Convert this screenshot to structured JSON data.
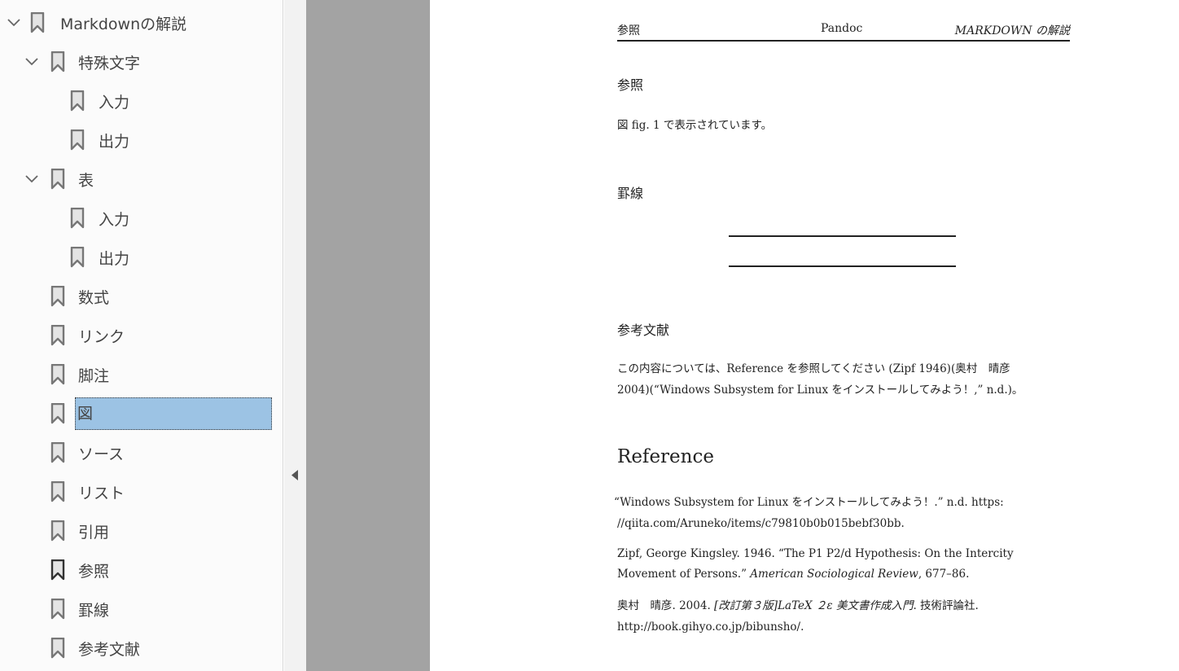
{
  "sidebar": {
    "items": [
      {
        "label": "Markdownの解説",
        "level": 0,
        "expanded": true
      },
      {
        "label": "特殊文字",
        "level": 1,
        "expanded": true
      },
      {
        "label": "入力",
        "level": 2
      },
      {
        "label": "出力",
        "level": 2
      },
      {
        "label": "表",
        "level": 1,
        "expanded": true
      },
      {
        "label": "入力",
        "level": 2
      },
      {
        "label": "出力",
        "level": 2
      },
      {
        "label": "数式",
        "level": 1
      },
      {
        "label": "リンク",
        "level": 1
      },
      {
        "label": "脚注",
        "level": 1
      },
      {
        "label": "図",
        "level": 1,
        "selected": true
      },
      {
        "label": "ソース",
        "level": 1
      },
      {
        "label": "リスト",
        "level": 1
      },
      {
        "label": "引用",
        "level": 1
      },
      {
        "label": "参照",
        "level": 1,
        "current": true
      },
      {
        "label": "罫線",
        "level": 1
      },
      {
        "label": "参考文献",
        "level": 1
      }
    ]
  },
  "selection_color": "#9cc3e4",
  "page": {
    "header": {
      "left": "参照",
      "center": "Pandoc",
      "right": "MARKDOWN の解説"
    },
    "sec1": {
      "title": "参照",
      "text": "図 fig. 1 で表示されています。"
    },
    "sec2": {
      "title": "罫線"
    },
    "sec3": {
      "title": "参考文献",
      "line1": "この内容については、Reference を参照してください (Zipf 1946)(奥村　晴彦",
      "line2": "2004)(“Windows Subsystem for Linux をインストールしてみよう！,” n.d.)。"
    },
    "ref": {
      "title": "Reference",
      "r1a": "“Windows Subsystem for Linux をインストールしてみよう！.” n.d. https:",
      "r1b": "//qiita.com/Aruneko/items/c79810b0b015bebf30bb.",
      "r2a": "Zipf, George Kingsley. 1946. “The P1 P2/d Hypothesis: On the Intercity",
      "r2b_pre": "Movement of Persons.” ",
      "r2b_journal": "American Sociological Review",
      "r2b_post": ", 677–86.",
      "r3a_pre": "奥村　晴彦. 2004. ",
      "r3a_title": "[改訂第３版]LaTeX ２ε 美文書作成入門",
      "r3a_post": ". 技術評論社.",
      "r3b": "http://book.gihyo.co.jp/bibunsho/."
    }
  }
}
